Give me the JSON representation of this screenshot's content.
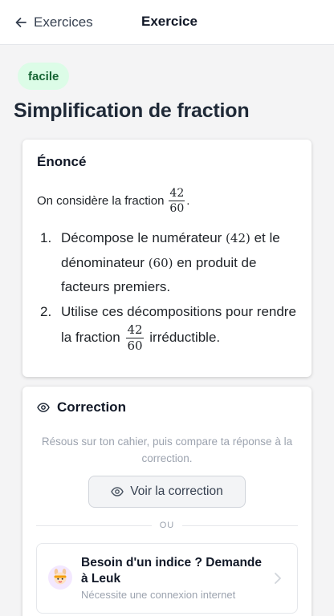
{
  "header": {
    "back_label": "Exercices",
    "title": "Exercice"
  },
  "badge": {
    "label": "facile"
  },
  "page_title": "Simplification de fraction",
  "enonce": {
    "heading": "Énoncé",
    "intro": "On considère la fraction",
    "fraction": {
      "num": "42",
      "den": "60"
    },
    "intro_end": ".",
    "steps": [
      {
        "num": "1.",
        "part1": "Décompose le numérateur ",
        "math1": "(42)",
        "part2": " et le dénominateur ",
        "math2": "(60)",
        "part3": " en produit de facteurs premiers."
      },
      {
        "num": "2.",
        "part1": "Utilise ces décompositions pour rendre la fraction",
        "fraction": {
          "num": "42",
          "den": "60"
        },
        "part2": "irréductible."
      }
    ]
  },
  "correction": {
    "heading": "Correction",
    "hint_text": "Résous sur ton cahier, puis compare ta réponse à la correction.",
    "button_label": "Voir la correction",
    "divider_label": "OU",
    "ask": {
      "title": "Besoin d'un indice ? Demande à Leuk",
      "subtitle": "Nécessite une connexion internet"
    }
  },
  "colors": {
    "background": "#f4f4f5",
    "badge_bg": "#dcfce7",
    "badge_text": "#166534",
    "muted_text": "#9ca3af"
  },
  "icons": {
    "back": "arrow-left-icon",
    "correction": "eye-icon",
    "button": "eye-icon",
    "avatar": "leuk-mascot-icon",
    "chevron": "chevron-right-icon"
  }
}
